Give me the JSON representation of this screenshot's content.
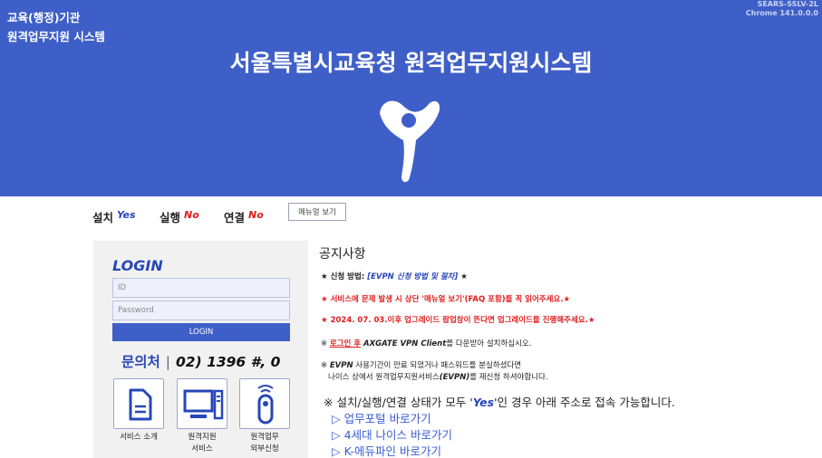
{
  "header": {
    "org_line1": "교육(행정)기관",
    "org_line2": "원격업무지원 시스템",
    "version_line1": "SEARS-SSLV-2L",
    "version_line2": "Chrome 141.0.0.0",
    "title": "서울특별시교육청 원격업무지원시스템"
  },
  "status": {
    "install_label": "설치",
    "install_value": "Yes",
    "run_label": "실행",
    "run_value": "No",
    "connect_label": "연결",
    "connect_value": "No",
    "manual_button": "메뉴얼 보기"
  },
  "login": {
    "title": "LOGIN",
    "id_placeholder": "ID",
    "pw_placeholder": "Password",
    "button": "LOGIN",
    "contact_label": "문의처",
    "contact_sep": "|",
    "contact_number": "02) 1396 #, 0",
    "tiles": [
      {
        "line1": "서비스 소개",
        "line2": ""
      },
      {
        "line1": "원격지원",
        "line2": "서비스"
      },
      {
        "line1": "원격업무",
        "line2": "외부신청"
      }
    ]
  },
  "notice": {
    "title": "공지사항",
    "line1_prefix": "★ 신청 방법: ",
    "line1_link": "[EVPN 신청 방법 및 절차]",
    "line1_suffix": " ★",
    "line2": "★ 서비스에 문제 발생 시 상단 '매뉴얼 보기'(FAQ 포함)를 꼭 읽어주세요.★",
    "line3": "★ 2024. 07. 03.이후 업그레이드 팝업창이 뜬다면 업그레이드를 진행해주세요.★",
    "line4_mark": "※ ",
    "line4_red": "로그인 후",
    "line4_bold": " AXGATE VPN Client",
    "line4_rest": "를 다운받아 설치하십시오.",
    "line5_mark": "※ ",
    "line5_bold": "EVPN",
    "line5_rest": " 사용기간이 만료 되었거나 패스워드를 분실하셨다면",
    "line6_pre": "나이스 상에서 원격업무지원서비스",
    "line6_bold": "(EVPN)",
    "line6_rest": "를 재신청 하셔야합니다.",
    "avail_pre": "※ 설치/실행/연결 상태가 모두 '",
    "avail_yes": "Yes",
    "avail_post": "'인 경우 아래 주소로 접속 가능합니다.",
    "links": [
      "업무포털 바로가기",
      "4세대 나이스 바로가기",
      "K-에듀파인 바로가기"
    ],
    "link_arrow": "▷"
  },
  "colors": {
    "brand_blue": "#3f5fc8",
    "accent_blue": "#2747b8",
    "alert_red": "#e01e1e"
  },
  "icons": {
    "logo": "seoul-education-logo",
    "tile1": "document-icon",
    "tile2": "monitor-icon",
    "tile3": "remote-device-icon"
  }
}
